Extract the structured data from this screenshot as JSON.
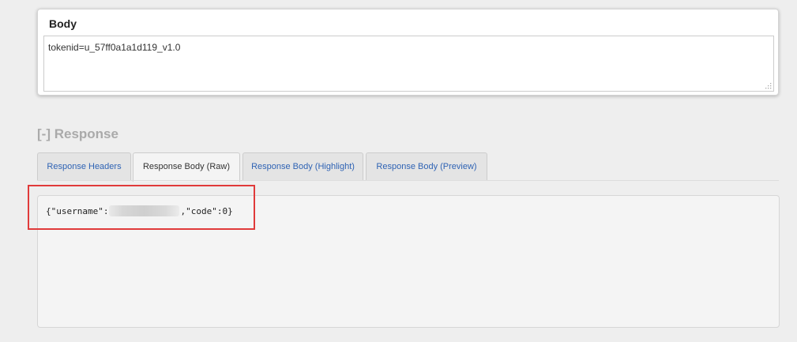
{
  "body_section": {
    "title": "Body",
    "textarea_value": "tokenid=u_57ff0a1a1d119_v1.0"
  },
  "response_section": {
    "heading": "[-] Response",
    "tabs": [
      {
        "label": "Response Headers",
        "active": false
      },
      {
        "label": "Response Body (Raw)",
        "active": true
      },
      {
        "label": "Response Body (Highlight)",
        "active": false
      },
      {
        "label": "Response Body (Preview)",
        "active": false
      }
    ],
    "raw_body": {
      "prefix": "{\"username\":",
      "suffix": ",\"code\":0}"
    }
  },
  "colors": {
    "link_tab": "#2f63b4",
    "highlight_border": "#e03a3a",
    "heading_gray": "#aaaaaa"
  }
}
